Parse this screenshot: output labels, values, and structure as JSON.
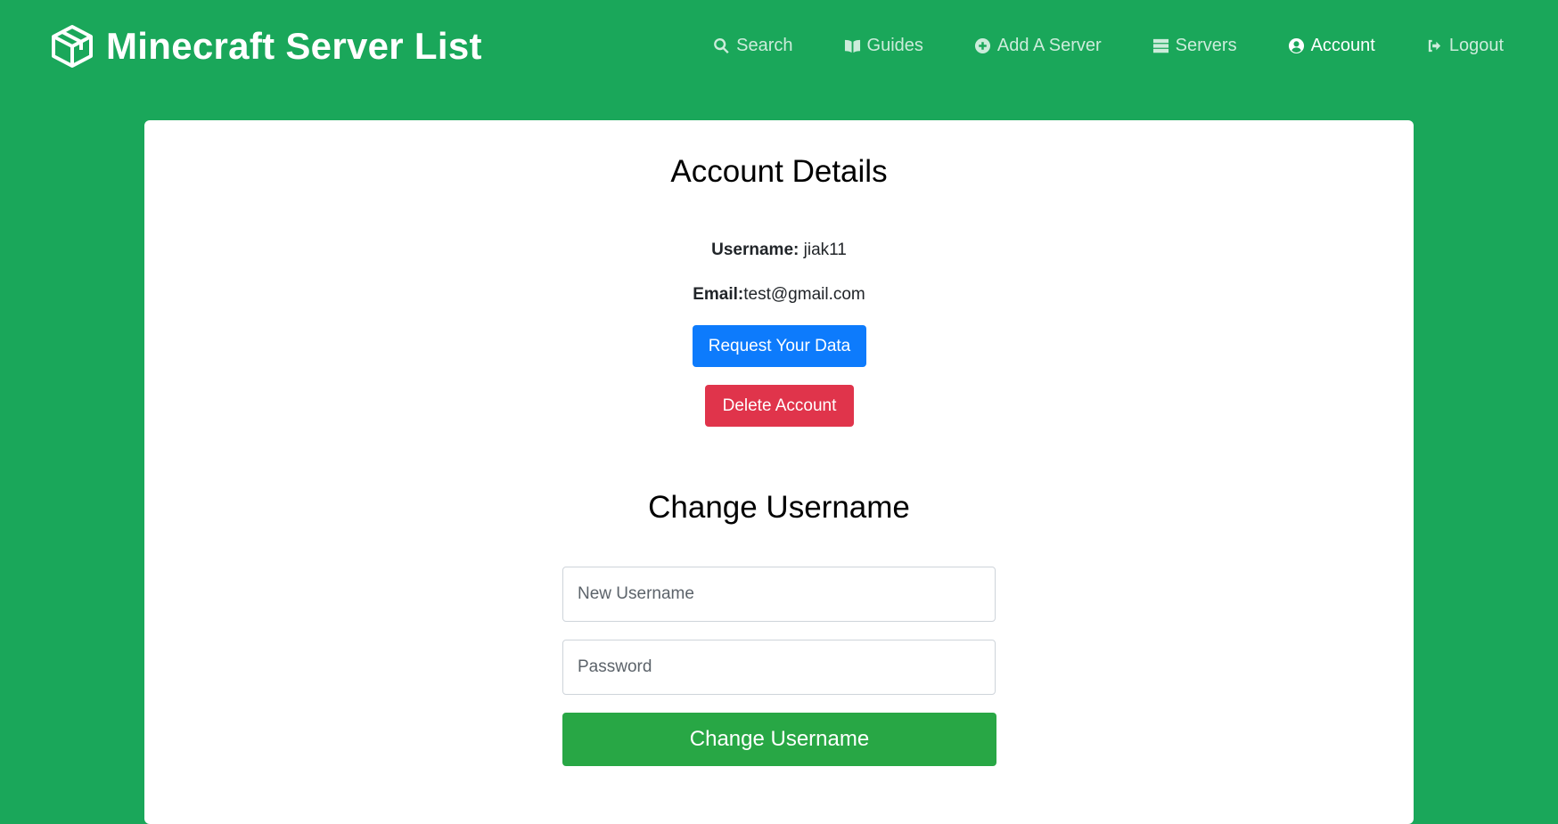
{
  "brand": {
    "title": "Minecraft Server List",
    "logo": "cube-icon"
  },
  "nav": {
    "items": [
      {
        "label": "Search",
        "icon": "search-icon"
      },
      {
        "label": "Guides",
        "icon": "book-icon"
      },
      {
        "label": "Add A Server",
        "icon": "plus-circle-icon"
      },
      {
        "label": "Servers",
        "icon": "server-icon"
      },
      {
        "label": "Account",
        "icon": "user-circle-icon",
        "active": true
      },
      {
        "label": "Logout",
        "icon": "sign-out-icon"
      }
    ]
  },
  "account": {
    "title": "Account Details",
    "username_label": "Username:",
    "username_value": " jiak11",
    "email_label": "Email:",
    "email_value": "test@gmail.com",
    "request_data_label": "Request Your Data",
    "delete_account_label": "Delete Account"
  },
  "change_username": {
    "title": "Change Username",
    "new_username_placeholder": "New Username",
    "password_placeholder": "Password",
    "submit_label": "Change Username"
  },
  "colors": {
    "background": "#1aa75a",
    "primary": "#0d7bfc",
    "danger": "#e0344b",
    "success": "#28a745"
  }
}
